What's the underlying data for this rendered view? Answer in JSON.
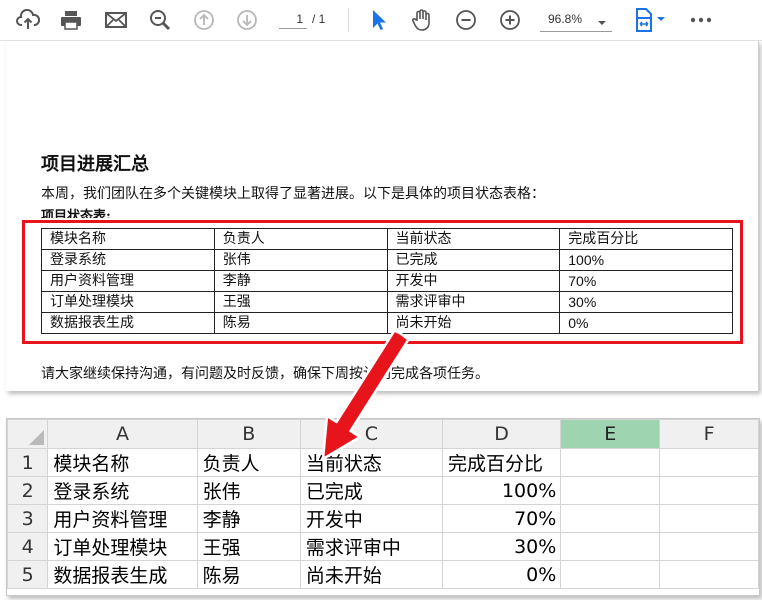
{
  "toolbar": {
    "page_current": "1",
    "page_total": "/ 1",
    "zoom": "96.8%"
  },
  "document": {
    "heading": "项目进展汇总",
    "intro": "本周，我们团队在多个关键模块上取得了显著进展。以下是具体的项目状态表格：",
    "table_title": "项目状态表:",
    "columns": [
      "模块名称",
      "负责人",
      "当前状态",
      "完成百分比"
    ],
    "rows": [
      [
        "登录系统",
        "张伟",
        "已完成",
        "100%"
      ],
      [
        "用户资料管理",
        "李静",
        "开发中",
        "70%"
      ],
      [
        "订单处理模块",
        "王强",
        "需求评审中",
        "30%"
      ],
      [
        "数据报表生成",
        "陈易",
        "尚未开始",
        "0%"
      ]
    ],
    "footer": "请大家继续保持沟通，有问题及时反馈，确保下周按计划完成各项任务。"
  },
  "spreadsheet": {
    "column_headers": [
      "A",
      "B",
      "C",
      "D",
      "E",
      "F"
    ],
    "selected_column": "E",
    "row_numbers": [
      "1",
      "2",
      "3",
      "4",
      "5"
    ],
    "cells": [
      [
        "模块名称",
        "负责人",
        "当前状态",
        "完成百分比"
      ],
      [
        "登录系统",
        "张伟",
        "已完成",
        "100%"
      ],
      [
        "用户资料管理",
        "李静",
        "开发中",
        "70%"
      ],
      [
        "订单处理模块",
        "王强",
        "需求评审中",
        "30%"
      ],
      [
        "数据报表生成",
        "陈易",
        "尚未开始",
        "0%"
      ]
    ]
  },
  "colors": {
    "highlight": "#e8141c",
    "accent_blue": "#1a73e8",
    "selected_column": "#9fd4b1"
  },
  "icons": [
    "cloud-upload-icon",
    "print-icon",
    "mail-icon",
    "zoom-search-icon",
    "page-up-icon",
    "page-down-icon",
    "select-cursor-icon",
    "hand-icon",
    "zoom-out-icon",
    "zoom-in-icon",
    "chevron-down-icon",
    "fit-page-icon",
    "more-icon"
  ]
}
